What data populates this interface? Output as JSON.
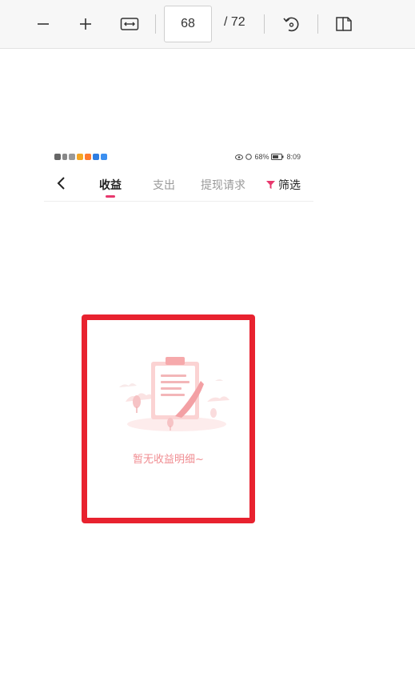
{
  "viewer": {
    "zoom_out_icon": "minus-icon",
    "zoom_in_icon": "plus-icon",
    "fit_width_icon": "fit-width-icon",
    "current_page": "68",
    "total_pages": "/ 72",
    "rotate_icon": "rotate-icon",
    "page_view_icon": "two-page-icon"
  },
  "phone": {
    "status_bar": {
      "battery": "68%",
      "time": "8:09"
    },
    "nav": {
      "back_icon": "chevron-left-icon",
      "tabs": [
        {
          "label": "收益",
          "active": true
        },
        {
          "label": "支出",
          "active": false
        },
        {
          "label": "提现请求",
          "active": false
        }
      ],
      "filter_label": "筛选",
      "filter_icon": "funnel-icon",
      "accent_color": "#e8386d"
    },
    "empty_state": {
      "illustration_icon": "clipboard-icon",
      "message": "暂无收益明细~"
    }
  },
  "highlight_color": "#e8222f"
}
